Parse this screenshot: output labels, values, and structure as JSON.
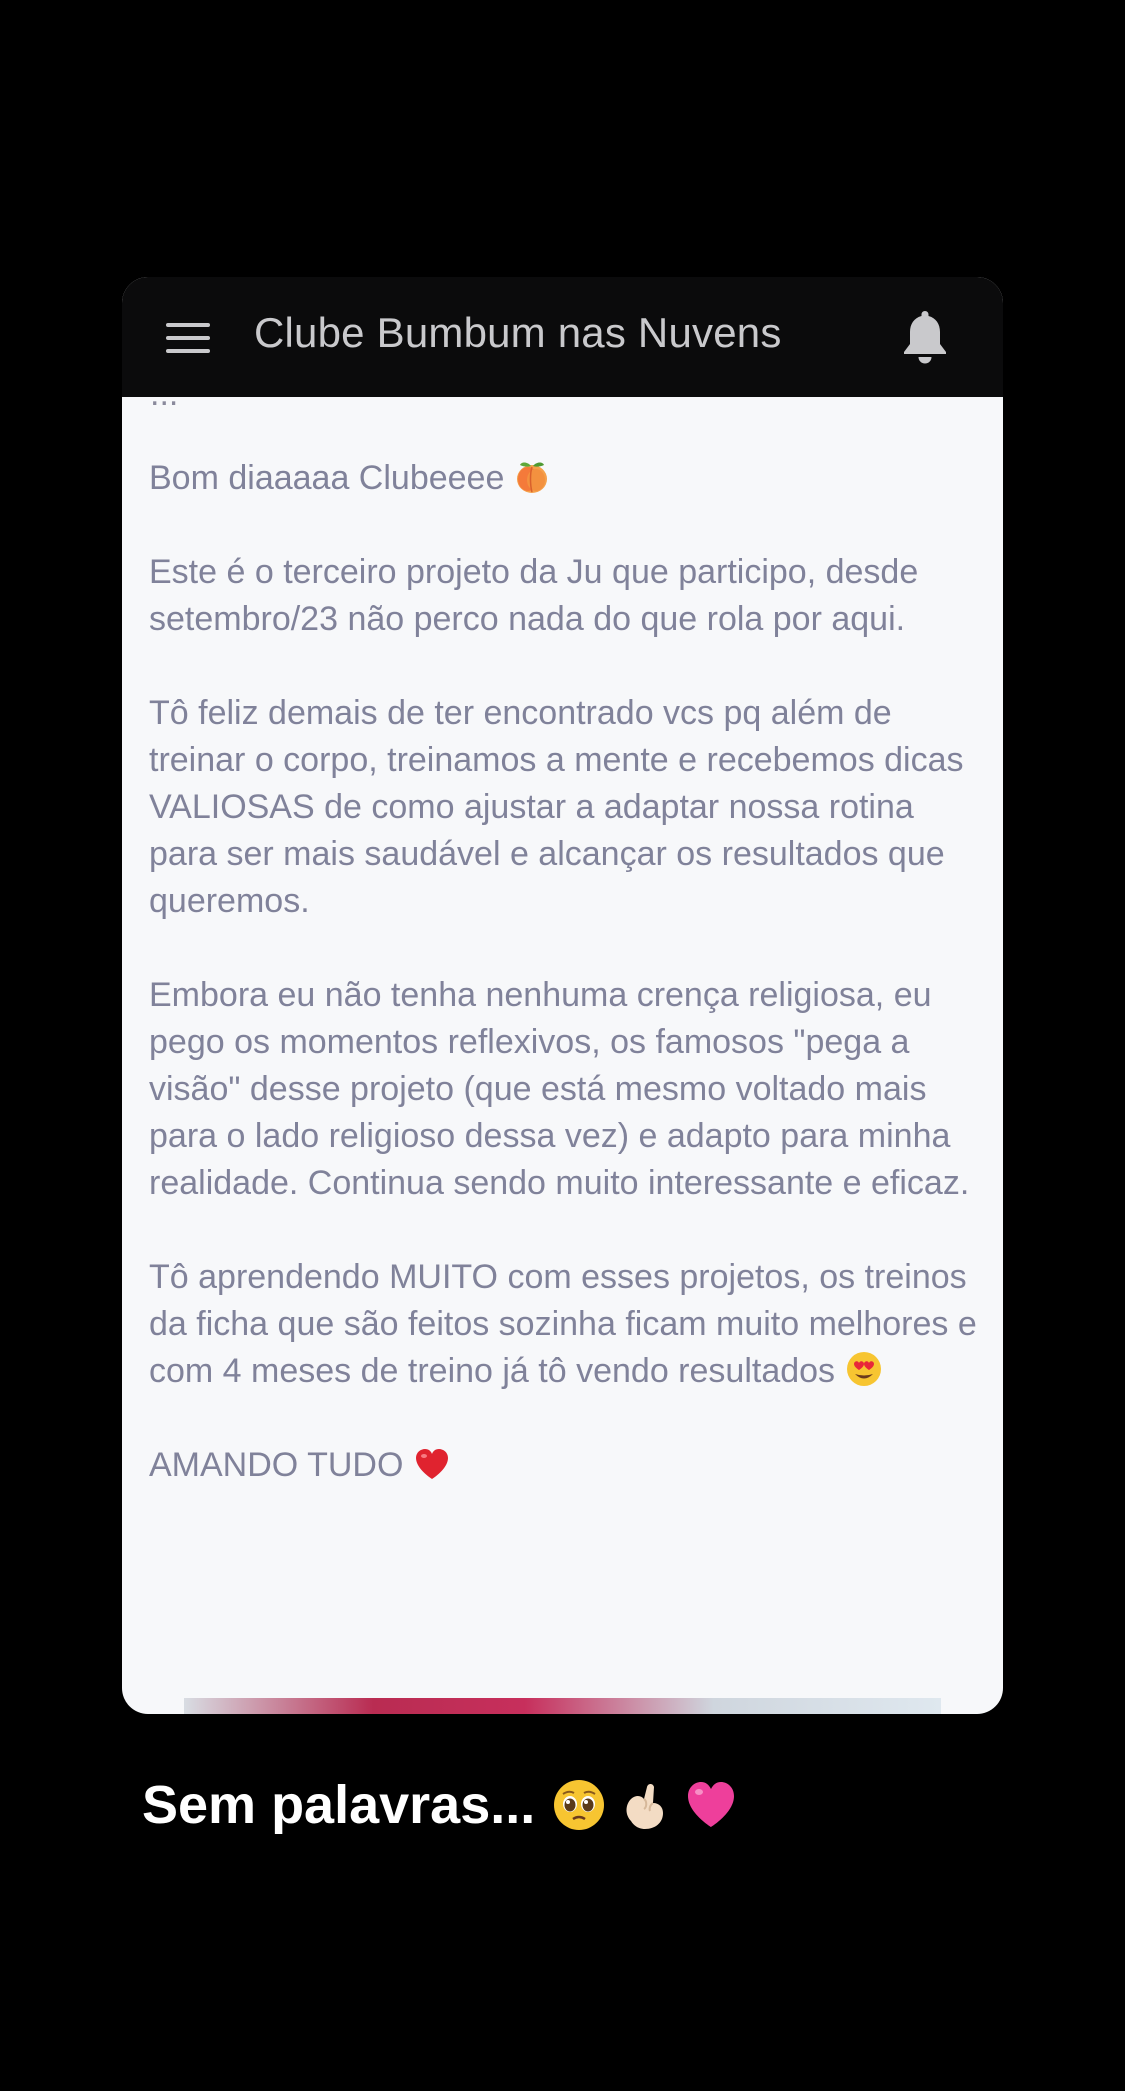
{
  "appbar": {
    "title": "Clube Bumbum nas Nuvens"
  },
  "post": {
    "cut_off_line": "...",
    "paragraphs": [
      {
        "text": "Bom diaaaaa Clubeeee",
        "emoji": "peach-emoji"
      },
      {
        "text": "Este é o terceiro projeto da Ju que participo, desde setembro/23 não perco nada do que rola por aqui."
      },
      {
        "text": "Tô feliz demais de ter encontrado vcs pq além de treinar o corpo, treinamos a mente e recebemos dicas VALIOSAS de como ajustar a adaptar nossa rotina para ser mais saudável e alcançar os resultados que queremos."
      },
      {
        "text": "Embora eu não tenha nenhuma crença religiosa, eu pego os momentos reflexivos, os famosos \"pega a visão\" desse projeto (que está mesmo voltado mais para o lado religioso dessa vez) e adapto para minha realidade. Continua sendo muito interessante e eficaz."
      },
      {
        "text": "Tô aprendendo MUITO com esses projetos, os treinos da ficha que são feitos sozinha ficam muito melhores e com 4 meses de treino já tô vendo resultados",
        "emoji": "heart-eyes-emoji"
      },
      {
        "text": "AMANDO TUDO",
        "emoji": "red-heart-emoji"
      }
    ]
  },
  "story_caption": {
    "text": "Sem palavras...",
    "emojis": [
      "pleading-face-emoji",
      "pinching-hand-emoji",
      "pink-heart-emoji"
    ]
  },
  "colors": {
    "background": "#000000",
    "appbar": "#0b0b0c",
    "card": "#f7f8fa",
    "post_text": "#80829a",
    "caption": "#ffffff"
  }
}
